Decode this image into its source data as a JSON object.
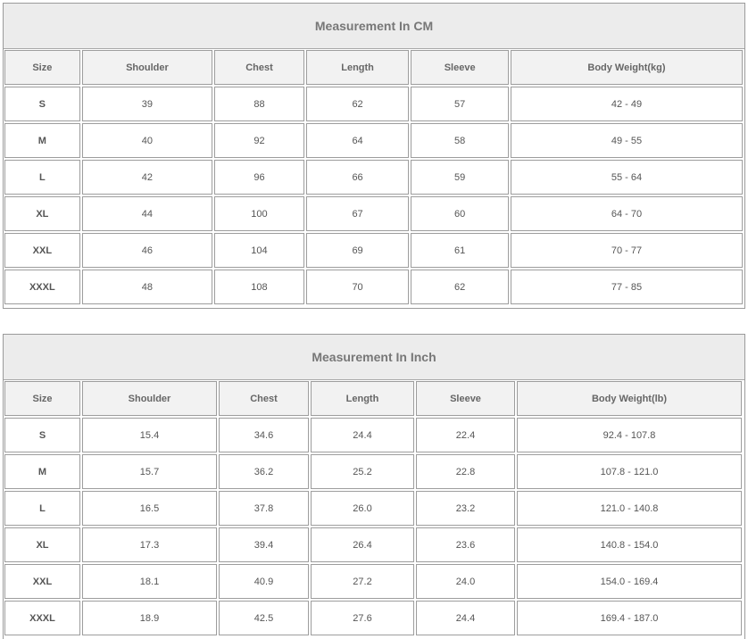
{
  "cm_table": {
    "title": "Measurement In CM",
    "headers": [
      "Size",
      "Shoulder",
      "Chest",
      "Length",
      "Sleeve",
      "Body Weight(kg)"
    ],
    "rows": [
      [
        "S",
        "39",
        "88",
        "62",
        "57",
        "42 - 49"
      ],
      [
        "M",
        "40",
        "92",
        "64",
        "58",
        "49 - 55"
      ],
      [
        "L",
        "42",
        "96",
        "66",
        "59",
        "55 - 64"
      ],
      [
        "XL",
        "44",
        "100",
        "67",
        "60",
        "64 - 70"
      ],
      [
        "XXL",
        "46",
        "104",
        "69",
        "61",
        "70 - 77"
      ],
      [
        "XXXL",
        "48",
        "108",
        "70",
        "62",
        "77 - 85"
      ]
    ]
  },
  "inch_table": {
    "title": "Measurement In Inch",
    "headers": [
      "Size",
      "Shoulder",
      "Chest",
      "Length",
      "Sleeve",
      "Body Weight(lb)"
    ],
    "rows": [
      [
        "S",
        "15.4",
        "34.6",
        "24.4",
        "22.4",
        "92.4 - 107.8"
      ],
      [
        "M",
        "15.7",
        "36.2",
        "25.2",
        "22.8",
        "107.8 - 121.0"
      ],
      [
        "L",
        "16.5",
        "37.8",
        "26.0",
        "23.2",
        "121.0 - 140.8"
      ],
      [
        "XL",
        "17.3",
        "39.4",
        "26.4",
        "23.6",
        "140.8 - 154.0"
      ],
      [
        "XXL",
        "18.1",
        "40.9",
        "27.2",
        "24.0",
        "154.0 - 169.4"
      ],
      [
        "XXXL",
        "18.9",
        "42.5",
        "27.6",
        "24.4",
        "169.4 - 187.0"
      ]
    ]
  }
}
